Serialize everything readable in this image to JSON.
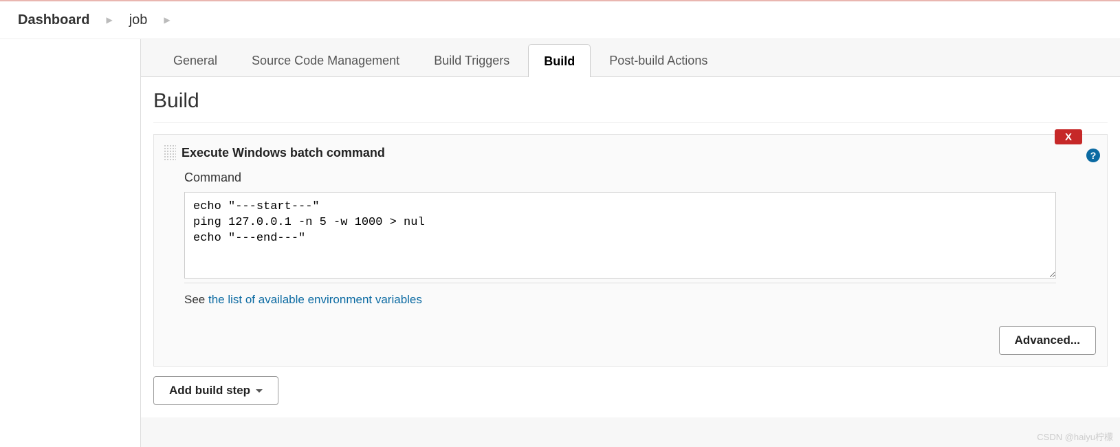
{
  "breadcrumb": {
    "dashboard": "Dashboard",
    "job": "job"
  },
  "tabs": {
    "general": "General",
    "scm": "Source Code Management",
    "triggers": "Build Triggers",
    "build": "Build",
    "post": "Post-build Actions"
  },
  "section": {
    "title": "Build"
  },
  "step": {
    "title": "Execute Windows batch command",
    "delete_label": "X",
    "help_label": "?",
    "field_label": "Command",
    "command_text": "echo \"---start---\"\nping 127.0.0.1 -n 5 -w 1000 > nul\necho \"---end---\"",
    "see_prefix": "See ",
    "see_link": "the list of available environment variables",
    "advanced_label": "Advanced..."
  },
  "add_step_label": "Add build step",
  "watermark": "CSDN @haiyu柠檬"
}
